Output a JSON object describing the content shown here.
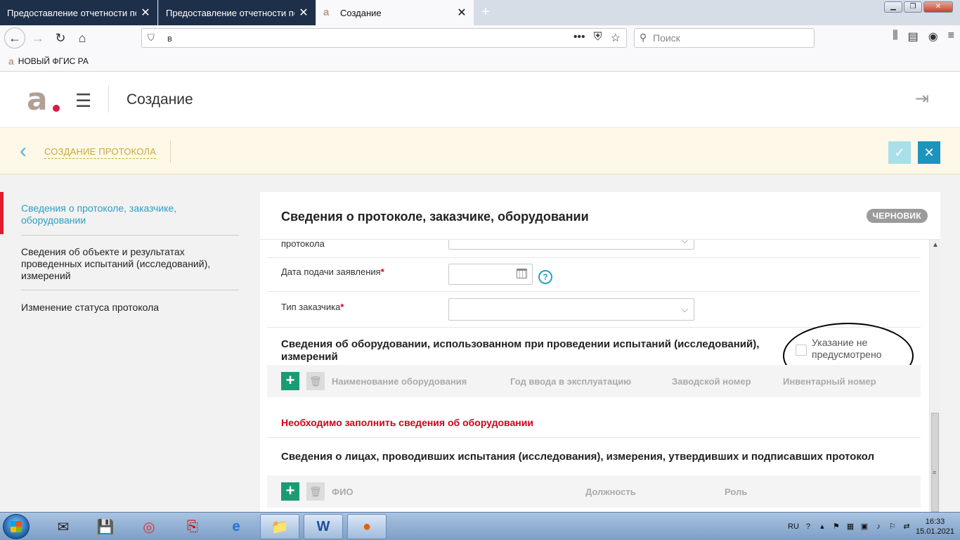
{
  "browser": {
    "tabs": [
      {
        "title": "Предоставление отчетности по те",
        "active": false
      },
      {
        "title": "Предоставление отчетности по те",
        "active": false
      },
      {
        "title": "Создание",
        "active": true
      }
    ],
    "url": "в",
    "search_placeholder": "Поиск",
    "bookmark": "НОВЫЙ ФГИС РА"
  },
  "header": {
    "page_title": "Создание"
  },
  "protocol_bar": {
    "link": "СОЗДАНИЕ ПРОТОКОЛА"
  },
  "sidebar": {
    "items": [
      {
        "label": "Сведения о протоколе, заказчике, оборудовании",
        "active": true
      },
      {
        "label": "Сведения об объекте и результатах проведенных испытаний (исследований), измерений",
        "active": false
      },
      {
        "label": "Изменение статуса протокола",
        "active": false
      }
    ]
  },
  "card": {
    "title": "Сведения о протоколе, заказчике, оборудовании",
    "badge": "ЧЕРНОВИК",
    "rows": {
      "protocol_label_tail": "протокола",
      "app_date_label": "Дата подачи заявления",
      "customer_type_label": "Тип заказчика",
      "required_mark": "*",
      "help_mark": "?"
    },
    "equipment": {
      "title": "Сведения об оборудовании, использованном при проведении испытаний (исследований), измерений",
      "not_required_label": "Указание не предусмотрено",
      "columns": [
        "Наименование оборудования",
        "Год ввода в эксплуатацию",
        "Заводской номер",
        "Инвентарный номер"
      ],
      "error": "Необходимо заполнить сведения об оборудовании"
    },
    "persons": {
      "title": "Сведения о лицах, проводивших испытания (исследования), измерения, утвердивших и подписавших протокол",
      "columns": [
        "ФИО",
        "Должность",
        "Роль"
      ]
    }
  },
  "taskbar": {
    "lang": "RU",
    "time": "16:33",
    "date": "15.01.2021"
  },
  "colors": {
    "accent": "#2a9fc6",
    "brand_dot": "#d41d4a",
    "error": "#d0021b",
    "add_button": "#1b9b73",
    "protocol_bar_bg": "#fdf8e7"
  }
}
